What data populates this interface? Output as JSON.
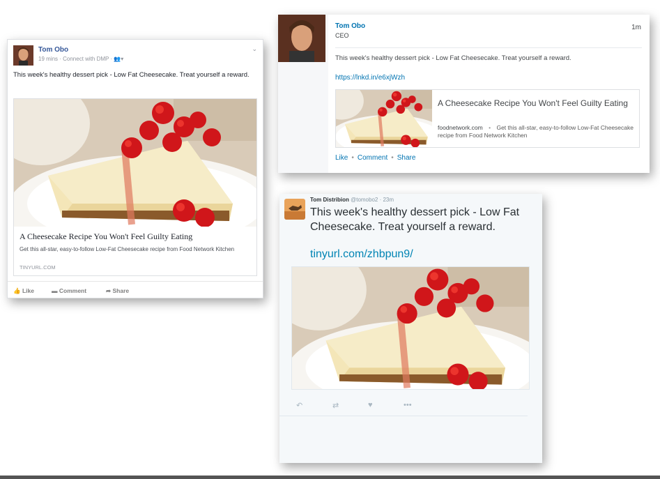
{
  "facebook": {
    "author": "Tom Obo",
    "meta": "19 mins · Connect with DMP ·",
    "post_text": "This week's healthy dessert pick - Low Fat Cheesecake. Treat yourself a reward.",
    "link_title": "A Cheesecake Recipe You Won't Feel Guilty Eating",
    "link_desc": "Get this all-star, easy-to-follow Low-Fat Cheesecake recipe from Food Network Kitchen",
    "link_domain": "TINYURL.COM",
    "like_label": "Like",
    "comment_label": "Comment",
    "share_label": "Share"
  },
  "linkedin": {
    "author": "Tom Obo",
    "job_title": "CEO",
    "time": "1m",
    "post_text": "This week's healthy dessert pick - Low Fat Cheesecake. Treat yourself a reward.",
    "url": "https://lnkd.in/e6xjWzh",
    "link_title": "A Cheesecake Recipe You Won't Feel Guilty Eating",
    "link_domain": "foodnetwork.com",
    "link_desc": "Get this all-star, easy-to-follow Low-Fat Cheesecake recipe from Food Network Kitchen",
    "like_label": "Like",
    "comment_label": "Comment",
    "share_label": "Share"
  },
  "twitter": {
    "author": "Tom Distribion",
    "handle": "@tomobo2 · 23m",
    "post_text": "This week's healthy dessert pick - Low Fat Cheesecake. Treat yourself a reward.",
    "url": "tinyurl.com/zhbpun9/"
  },
  "icons": {
    "reply": "reply-icon",
    "retweet": "retweet-icon",
    "like": "heart-icon",
    "more": "more-icon"
  },
  "colors": {
    "facebook_blue": "#365899",
    "linkedin_blue": "#0073b1",
    "twitter_blue": "#0084b4"
  }
}
